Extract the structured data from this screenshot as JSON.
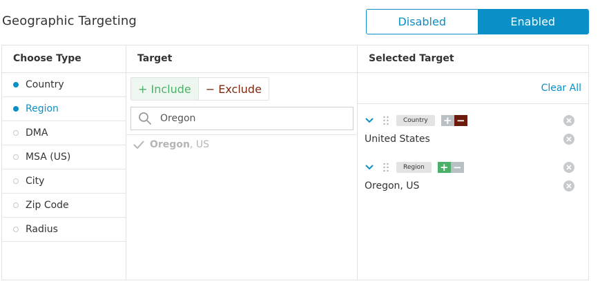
{
  "header": {
    "title": "Geographic Targeting",
    "toggle": {
      "off_label": "Disabled",
      "on_label": "Enabled",
      "selected": "Enabled"
    }
  },
  "columns": {
    "choose_type": "Choose Type",
    "target": "Target",
    "selected_target": "Selected Target"
  },
  "choose_type": {
    "items": [
      {
        "label": "Country",
        "filled": true,
        "active": false
      },
      {
        "label": "Region",
        "filled": true,
        "active": true
      },
      {
        "label": "DMA",
        "filled": false,
        "active": false
      },
      {
        "label": "MSA (US)",
        "filled": false,
        "active": false
      },
      {
        "label": "City",
        "filled": false,
        "active": false
      },
      {
        "label": "Zip Code",
        "filled": false,
        "active": false
      },
      {
        "label": "Radius",
        "filled": false,
        "active": false
      }
    ]
  },
  "target": {
    "include_label": "+ Include",
    "exclude_label": "− Exclude",
    "search_value": "Oregon",
    "result": {
      "name": "Oregon",
      "suffix": ", US"
    }
  },
  "selected": {
    "clear_all": "Clear All",
    "groups": [
      {
        "tag": "Country",
        "mode": "exclude",
        "value": "United States"
      },
      {
        "tag": "Region",
        "mode": "include",
        "value": "Oregon, US"
      }
    ]
  },
  "colors": {
    "accent": "#0a8fc6",
    "include_green": "#4caf6a",
    "exclude_dark": "#6b1a0c"
  }
}
